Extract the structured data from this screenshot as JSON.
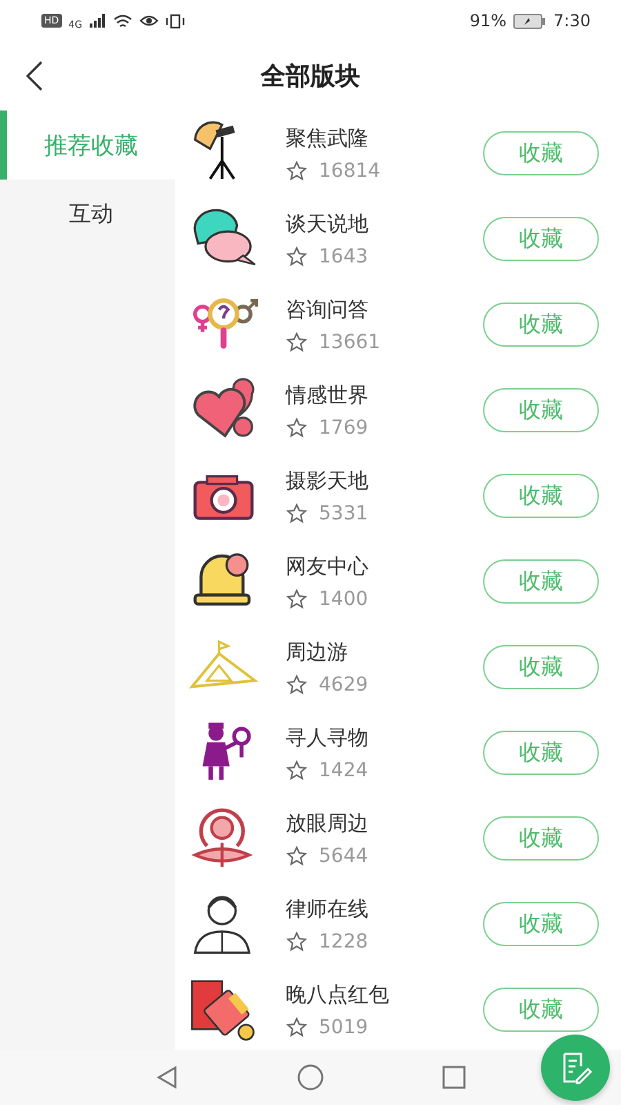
{
  "status_bar": {
    "hd": "HD",
    "network": "4G",
    "battery": "91%",
    "time": "7:30"
  },
  "header": {
    "title": "全部版块"
  },
  "sidebar": {
    "items": [
      {
        "label": "推荐收藏",
        "selected": true
      },
      {
        "label": "互动",
        "selected": false
      }
    ]
  },
  "boards": [
    {
      "name": "聚焦武隆",
      "count": "16814",
      "button": "收藏"
    },
    {
      "name": "谈天说地",
      "count": "1643",
      "button": "收藏"
    },
    {
      "name": "咨询问答",
      "count": "13661",
      "button": "收藏"
    },
    {
      "name": "情感世界",
      "count": "1769",
      "button": "收藏"
    },
    {
      "name": "摄影天地",
      "count": "5331",
      "button": "收藏"
    },
    {
      "name": "网友中心",
      "count": "1400",
      "button": "收藏"
    },
    {
      "name": "周边游",
      "count": "4629",
      "button": "收藏"
    },
    {
      "name": "寻人寻物",
      "count": "1424",
      "button": "收藏"
    },
    {
      "name": "放眼周边",
      "count": "5644",
      "button": "收藏"
    },
    {
      "name": "律师在线",
      "count": "1228",
      "button": "收藏"
    },
    {
      "name": "晚八点红包",
      "count": "5019",
      "button": "收藏"
    }
  ]
}
